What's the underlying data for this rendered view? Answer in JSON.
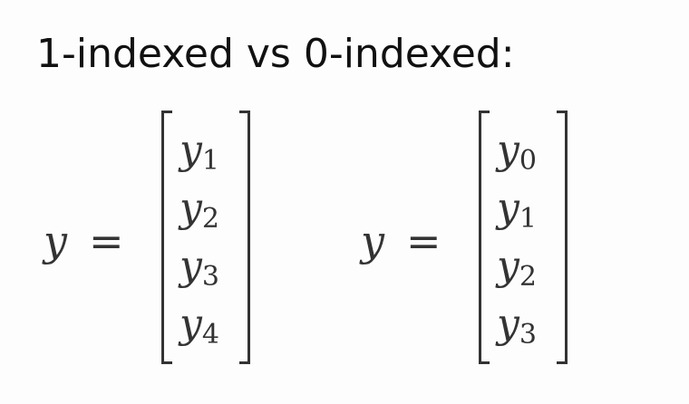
{
  "heading": "1-indexed vs 0-indexed:",
  "left_equation": {
    "variable": "y",
    "equals": "=",
    "entries": [
      {
        "base": "y",
        "sub": "1"
      },
      {
        "base": "y",
        "sub": "2"
      },
      {
        "base": "y",
        "sub": "3"
      },
      {
        "base": "y",
        "sub": "4"
      }
    ]
  },
  "right_equation": {
    "variable": "y",
    "equals": "=",
    "entries": [
      {
        "base": "y",
        "sub": "0"
      },
      {
        "base": "y",
        "sub": "1"
      },
      {
        "base": "y",
        "sub": "2"
      },
      {
        "base": "y",
        "sub": "3"
      }
    ]
  }
}
